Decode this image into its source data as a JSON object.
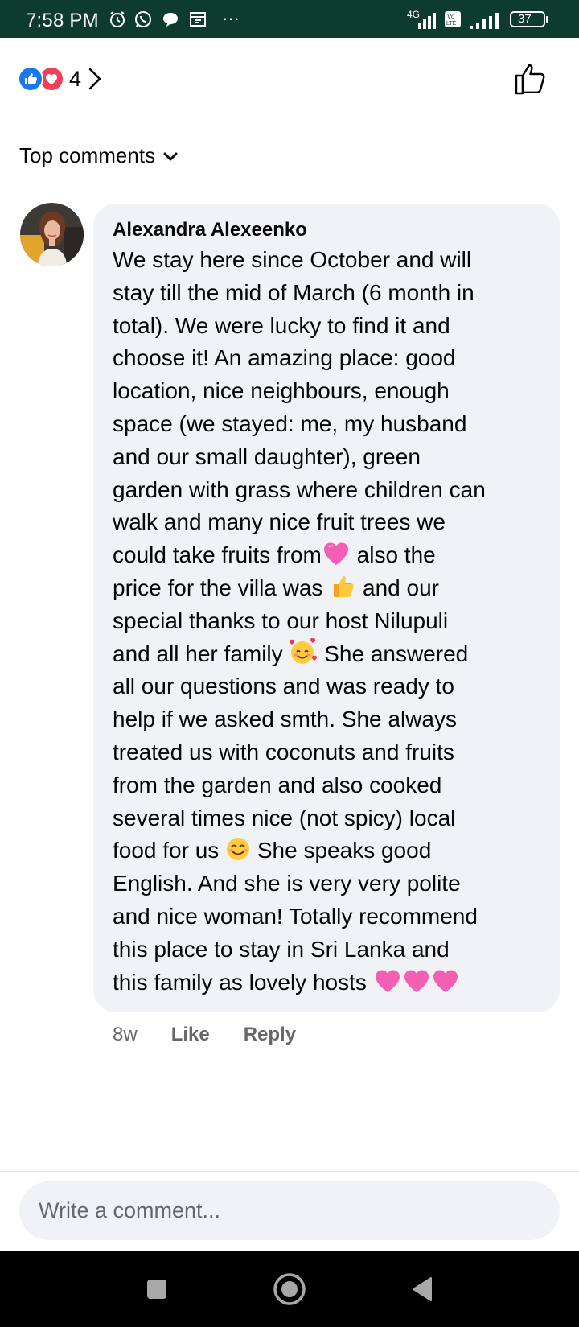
{
  "status_bar": {
    "time": "7:58 PM",
    "network": "4G",
    "volte": "Vo LTE",
    "battery": "37",
    "overflow": "···",
    "icons": [
      "alarm-icon",
      "whatsapp-icon",
      "chat-icon",
      "gallery-icon"
    ]
  },
  "reactions": {
    "count": "4",
    "types": [
      "like",
      "love"
    ],
    "like_color": "#1877f2",
    "love_color": "#f33e58"
  },
  "sort": {
    "label": "Top comments"
  },
  "comment": {
    "author": "Alexandra Alexeenko",
    "lines": [
      "We stay here since October and will",
      "stay till the mid of March (6 month in",
      "total). We were lucky to find it and",
      "choose it! An amazing place: good",
      "location, nice neighbours, enough",
      "space (we stayed: me, my husband",
      "and our small daughter), green",
      "garden with grass where children can",
      "walk and many nice fruit trees we",
      "could take fruits from",
      "also the",
      "price for the villa was",
      "and our",
      "special thanks to our host Nilupuli",
      "and all her family",
      "She answered",
      "all our questions and was ready to",
      "help if we asked smth. She always",
      "treated us with coconuts and fruits",
      "from the garden and also cooked",
      "several times nice (not spicy) local",
      "food for us",
      "She speaks good",
      "English. And she is very very polite",
      "and nice woman! Totally recommend",
      "this place to stay in Sri Lanka  and",
      "this family as lovely hosts"
    ],
    "emojis": [
      "pink-heart",
      "thumbs-up",
      "smiling-face-with-hearts",
      "smiling-face",
      "pink-heart",
      "pink-heart",
      "pink-heart"
    ],
    "time_ago": "8w",
    "like_label": "Like",
    "reply_label": "Reply"
  },
  "composer": {
    "placeholder": "Write a comment..."
  },
  "theme": {
    "status_bar_bg": "#0d3b2e",
    "bubble_bg": "#f0f2f5",
    "secondary_text": "#65676b"
  }
}
